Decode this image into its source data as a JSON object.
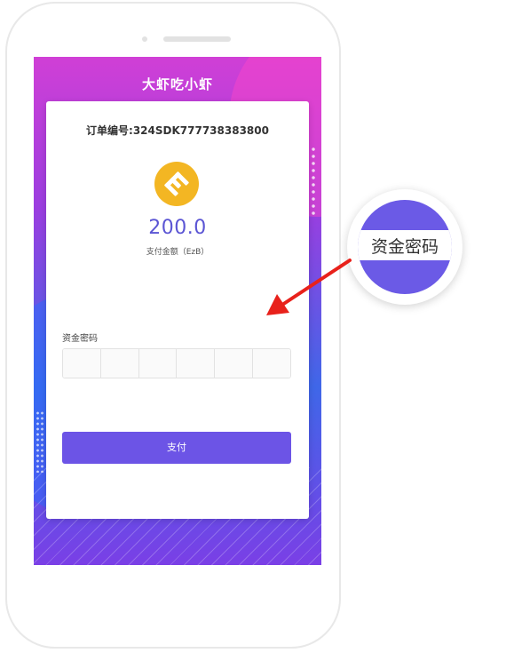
{
  "app": {
    "title": "大虾吃小虾"
  },
  "order": {
    "label": "订单编号:324SDK777738383800"
  },
  "payment": {
    "amount": "200.0",
    "sublabel": "支付金额（EzB）",
    "coin_icon": "ezb-coin-icon",
    "coin_color": "#f3b623"
  },
  "password": {
    "label": "资金密码",
    "box_count": 6
  },
  "pay_button": {
    "label": "支付",
    "color": "#6c54e6"
  },
  "callout": {
    "label": "资金密码"
  },
  "colors": {
    "accent": "#5b55d4",
    "arrow": "#e8211b"
  }
}
